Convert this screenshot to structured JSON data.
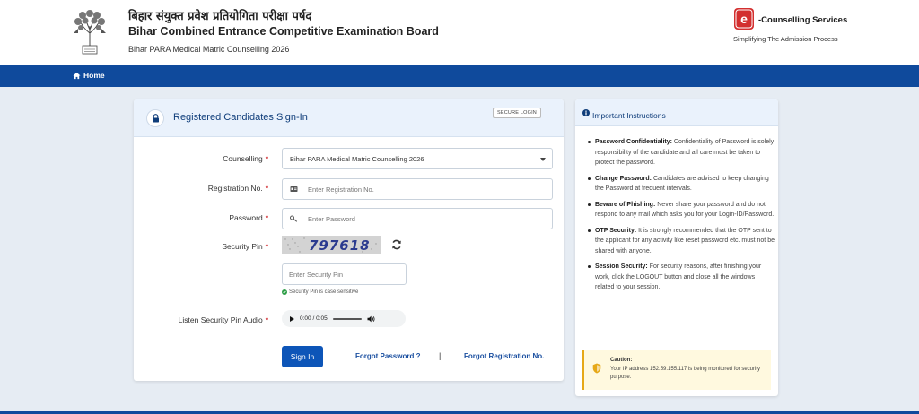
{
  "header": {
    "title_hindi": "बिहार संयुक्त प्रवेश प्रतियोगिता परीक्षा पर्षद",
    "title_english": "Bihar Combined Entrance Competitive Examination Board",
    "subtitle": "Bihar PARA Medical Matric Counselling 2026",
    "emblem_icon": "bihar-emblem-icon",
    "brand_logo_letter": "e",
    "brand_name": "-Counselling Services",
    "brand_tagline": "Simplifying The Admission Process"
  },
  "nav": {
    "home": "Home"
  },
  "signin": {
    "title": "Registered Candidates Sign-In",
    "badge": "SECURE LOGIN",
    "counselling_label": "Counselling",
    "counselling_value": "Bihar PARA Medical Matric Counselling 2026",
    "registration_label": "Registration No.",
    "registration_placeholder": "Enter Registration No.",
    "password_label": "Password",
    "password_placeholder": "Enter Password",
    "security_pin_label": "Security Pin",
    "captcha_text": "797618",
    "security_pin_placeholder": "Enter Security Pin",
    "pin_note": "Security Pin is case sensitive",
    "audio_label": "Listen Security Pin Audio",
    "audio_time": "0:00 / 0:05",
    "signin_button": "Sign In",
    "forgot_password": "Forgot Password ?",
    "separator": "|",
    "forgot_registration": "Forgot Registration No.",
    "required_marker": "*"
  },
  "instructions": {
    "title": "Important Instructions",
    "items": [
      {
        "heading": "Password Confidentiality:",
        "text": " Confidentiality of Password is solely responsibility of the candidate and all care must be taken to protect the password."
      },
      {
        "heading": "Change Password:",
        "text": " Candidates are advised to keep changing the Password at frequent intervals."
      },
      {
        "heading": "Beware of Phishing:",
        "text": " Never share your password and do not respond to any mail which asks you for your Login-ID/Password."
      },
      {
        "heading": "OTP Security:",
        "text": " It is strongly recommended that the OTP sent to the applicant for any activity like reset password etc. must not be shared with anyone."
      },
      {
        "heading": "Session Security:",
        "text": " For security reasons, after finishing your work, click the LOGOUT button and close all the windows related to your session."
      }
    ],
    "caution_title": "Caution:",
    "caution_text": "Your IP address 152.59.155.117 is being monitored for security purpose."
  },
  "colors": {
    "nav_blue": "#0f4a9c",
    "button_blue": "#0d55b8",
    "required_red": "#d0252a",
    "brand_red": "#d32f2f",
    "caution_border": "#e6a817"
  }
}
